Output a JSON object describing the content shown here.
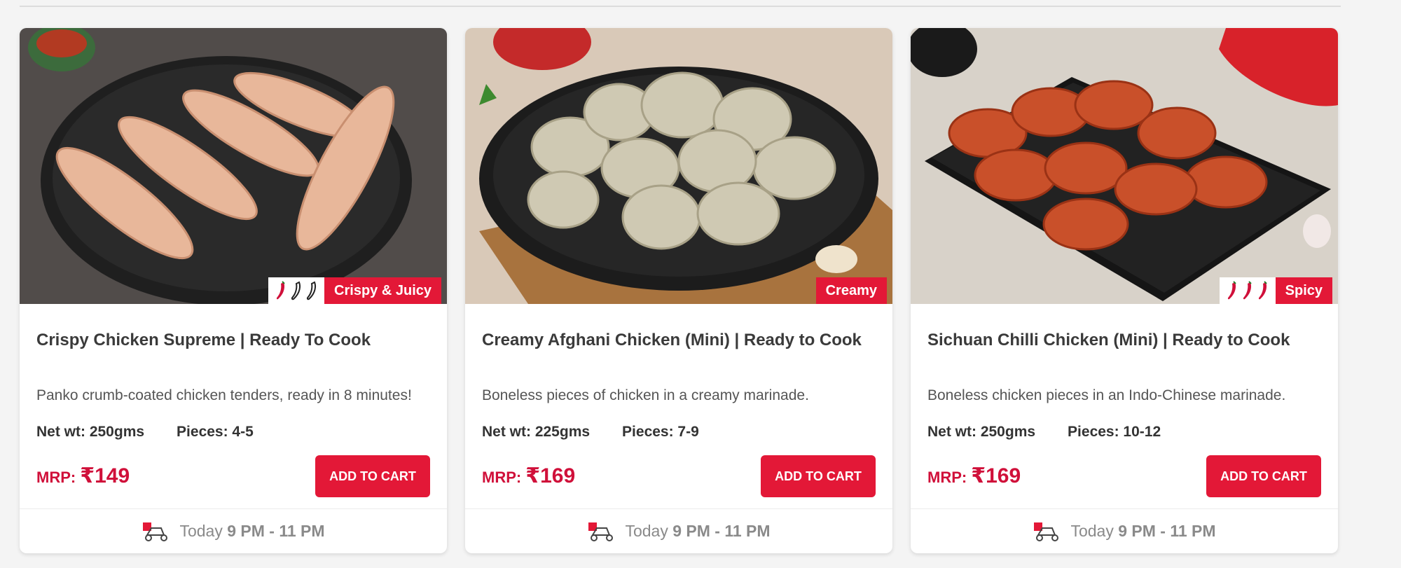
{
  "accent_color": "#e31837",
  "products": [
    {
      "title": "Crispy Chicken Supreme | Ready To Cook",
      "description": "Panko crumb-coated chicken tenders, ready in 8 minutes!",
      "net_wt_label": "Net wt: 250gms",
      "pieces_label": "Pieces: 4-5",
      "mrp_label": "MRP:",
      "price": "₹149",
      "tag": "Crispy & Juicy",
      "spice_icons": [
        "chili-icon",
        "chili-outline-icon",
        "chili-outline-icon"
      ],
      "add_to_cart": "ADD TO CART",
      "delivery_day": "Today",
      "delivery_slot": "9 PM - 11 PM"
    },
    {
      "title": "Creamy Afghani Chicken (Mini) | Ready to Cook",
      "description": "Boneless pieces of chicken in a creamy marinade.",
      "net_wt_label": "Net wt: 225gms",
      "pieces_label": "Pieces: 7-9",
      "mrp_label": "MRP:",
      "price": "₹169",
      "tag": "Creamy",
      "spice_icons": [],
      "add_to_cart": "ADD TO CART",
      "delivery_day": "Today",
      "delivery_slot": "9 PM - 11 PM"
    },
    {
      "title": "Sichuan Chilli Chicken (Mini) | Ready to Cook",
      "description": "Boneless chicken pieces in an Indo-Chinese marinade.",
      "net_wt_label": "Net wt: 250gms",
      "pieces_label": "Pieces: 10-12",
      "mrp_label": "MRP:",
      "price": "₹169",
      "tag": "Spicy",
      "spice_icons": [
        "chili-icon",
        "chili-icon",
        "chili-icon"
      ],
      "add_to_cart": "ADD TO CART",
      "delivery_day": "Today",
      "delivery_slot": "9 PM - 11 PM"
    }
  ]
}
